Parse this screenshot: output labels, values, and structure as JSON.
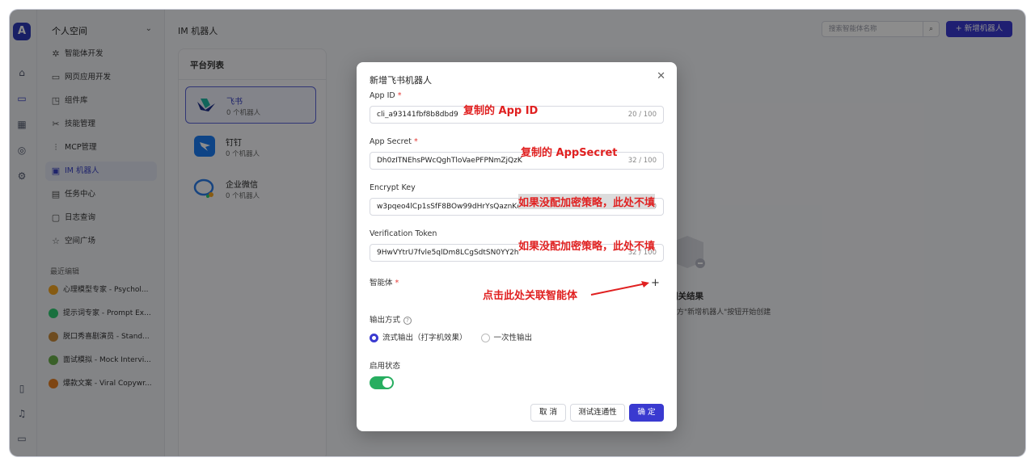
{
  "app": {
    "logo_letter": "A"
  },
  "sidebar": {
    "workspace": "个人空间",
    "items": [
      {
        "label": "智能体开发",
        "icon": "agent-dev-icon"
      },
      {
        "label": "网页应用开发",
        "icon": "web-app-icon"
      },
      {
        "label": "组件库",
        "icon": "component-icon"
      },
      {
        "label": "技能管理",
        "icon": "skill-icon"
      },
      {
        "label": "MCP管理",
        "icon": "mcp-icon"
      },
      {
        "label": "IM 机器人",
        "icon": "im-bot-icon"
      },
      {
        "label": "任务中心",
        "icon": "task-icon"
      },
      {
        "label": "日志查询",
        "icon": "log-icon"
      },
      {
        "label": "空间广场",
        "icon": "star-icon"
      }
    ],
    "recent_title": "最近编辑",
    "recent": [
      {
        "label": "心理模型专家 - Psychol...",
        "color": "#f5a623"
      },
      {
        "label": "提示词专家 - Prompt Ex...",
        "color": "#2ecc71"
      },
      {
        "label": "脱口秀喜剧演员 - Stand...",
        "color": "#c98b3b"
      },
      {
        "label": "面试模拟 - Mock Intervi...",
        "color": "#6ab04c"
      },
      {
        "label": "爆款文案 - Viral Copywr...",
        "color": "#e67e22"
      }
    ]
  },
  "header": {
    "title": "IM 机器人",
    "search_placeholder": "搜索智能体名称",
    "add_button": "+ 新增机器人"
  },
  "platforms": {
    "title": "平台列表",
    "items": [
      {
        "name": "飞书",
        "count": "0 个机器人",
        "color": "#1fb8a6"
      },
      {
        "name": "钉钉",
        "count": "0 个机器人",
        "color": "#1a7cf5"
      },
      {
        "name": "企业微信",
        "count": "0 个机器人",
        "color": "#2b7de9"
      }
    ]
  },
  "empty": {
    "title": "相关结果",
    "subtitle": "上方\"新增机器人\"按钮开始创建"
  },
  "modal": {
    "title": "新增飞书机器人",
    "fields": [
      {
        "label": "App ID",
        "required": "*",
        "value": "cli_a93141fbf8b8dbd9",
        "count": "20 / 100",
        "note": "复制的 App ID"
      },
      {
        "label": "App Secret",
        "required": "*",
        "value": "Dh0zITNEhsPWcQghTloVaePFPNmZjQzK",
        "count": "32 / 100",
        "note": "复制的 AppSecret"
      },
      {
        "label": "Encrypt Key",
        "required": "",
        "value": "w3pqeo4lCp1sSfF8BOw99dHrYsQaznKd",
        "count": "32 / 100",
        "note": "如果没配加密策略，此处不填"
      },
      {
        "label": "Verification Token",
        "required": "",
        "value": "9HwVYtrU7fvle5qlDm8LCgSdtSN0YY2h",
        "count": "32 / 100",
        "note": "如果没配加密策略，此处不填"
      }
    ],
    "agent_label": "智能体",
    "agent_required": "*",
    "agent_note": "点击此处关联智能体",
    "plus": "+",
    "output_label": "输出方式",
    "help": "?",
    "output_options": [
      "流式输出（打字机效果）",
      "一次性输出"
    ],
    "output_selected": 0,
    "status_label": "启用状态",
    "status_on": true,
    "buttons": {
      "cancel": "取 消",
      "test": "测试连通性",
      "ok": "确 定"
    },
    "close": "✕"
  }
}
